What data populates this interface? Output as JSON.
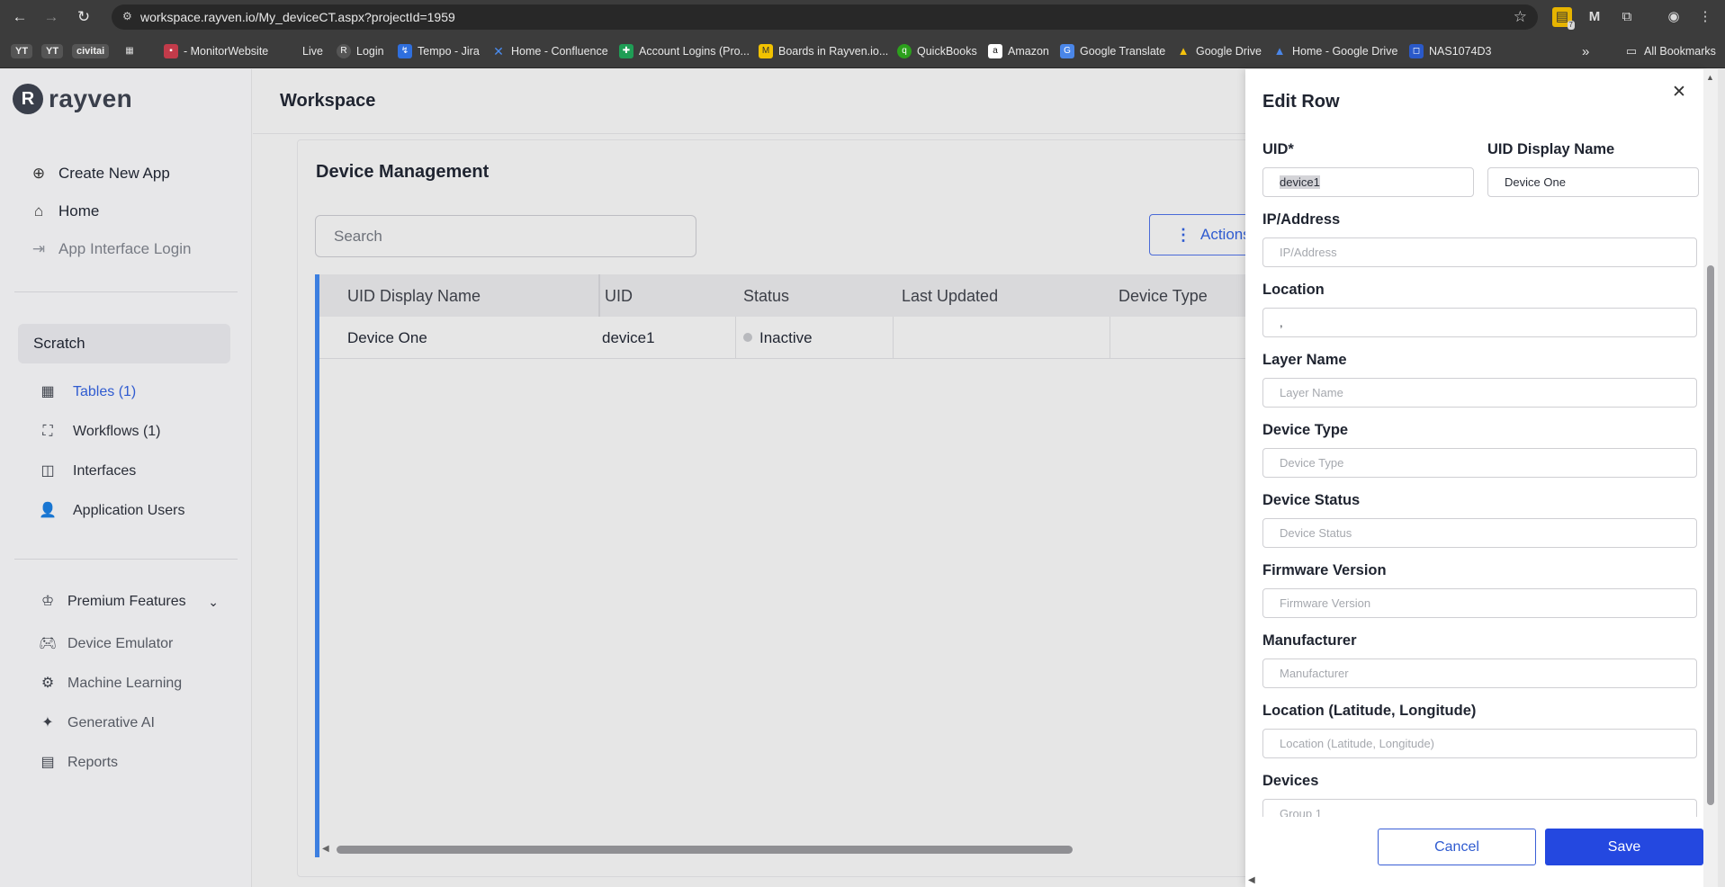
{
  "browser": {
    "url": "workspace.rayven.io/My_deviceCT.aspx?projectId=1959",
    "ext_badge": "7",
    "bookmarks": [
      {
        "label": "YT"
      },
      {
        "label": "YT"
      },
      {
        "label": "civitai"
      },
      {
        "label": "- MonitorWebsite"
      },
      {
        "label": "Live"
      },
      {
        "label": "Login"
      },
      {
        "label": "Tempo - Jira"
      },
      {
        "label": "Home - Confluence"
      },
      {
        "label": "Account Logins (Pro..."
      },
      {
        "label": "Boards in Rayven.io..."
      },
      {
        "label": "QuickBooks"
      },
      {
        "label": "Amazon"
      },
      {
        "label": "Google Translate"
      },
      {
        "label": "Google Drive"
      },
      {
        "label": "Home - Google Drive"
      },
      {
        "label": "NAS1074D3"
      }
    ],
    "more": "»",
    "all_bookmarks": "All Bookmarks"
  },
  "sidebar": {
    "logo_text": "rayven",
    "links": [
      {
        "label": "Create New App",
        "icon": "plus-circle-icon"
      },
      {
        "label": "Home",
        "icon": "home-icon"
      },
      {
        "label": "App Interface Login",
        "icon": "login-icon"
      }
    ],
    "section": "Scratch",
    "items": [
      {
        "label": "Tables (1)",
        "icon": "table-icon"
      },
      {
        "label": "Workflows (1)",
        "icon": "workflow-icon"
      },
      {
        "label": "Interfaces",
        "icon": "interface-icon"
      },
      {
        "label": "Application Users",
        "icon": "users-icon"
      }
    ],
    "premium": {
      "label": "Premium Features",
      "icon": "crown-icon"
    },
    "premium_items": [
      {
        "label": "Device Emulator",
        "icon": "gamepad-icon"
      },
      {
        "label": "Machine Learning",
        "icon": "chip-icon"
      },
      {
        "label": "Generative AI",
        "icon": "magic-wand-icon"
      },
      {
        "label": "Reports",
        "icon": "report-icon"
      }
    ]
  },
  "main": {
    "title": "Workspace",
    "card_title": "Device Management",
    "search_placeholder": "Search",
    "actions_label": "Actions",
    "table": {
      "columns": [
        "UID Display Name",
        "UID",
        "Status",
        "Last Updated",
        "Device Type"
      ],
      "rows": [
        {
          "display_name": "Device One",
          "uid": "device1",
          "status": "Inactive",
          "last_updated": "",
          "device_type": ""
        }
      ]
    }
  },
  "panel": {
    "title": "Edit Row",
    "fields": {
      "uid": {
        "label": "UID*",
        "value": "device1"
      },
      "uid_display": {
        "label": "UID Display Name",
        "value": "Device One"
      },
      "ip": {
        "label": "IP/Address",
        "placeholder": "IP/Address"
      },
      "location": {
        "label": "Location",
        "value": ","
      },
      "layer": {
        "label": "Layer Name",
        "placeholder": "Layer Name"
      },
      "device_type": {
        "label": "Device Type",
        "placeholder": "Device Type"
      },
      "device_status": {
        "label": "Device Status",
        "placeholder": "Device Status"
      },
      "firmware": {
        "label": "Firmware Version",
        "placeholder": "Firmware Version"
      },
      "manufacturer": {
        "label": "Manufacturer",
        "placeholder": "Manufacturer"
      },
      "latlng": {
        "label": "Location (Latitude, Longitude)",
        "placeholder": "Location (Latitude, Longitude)"
      },
      "devices": {
        "label": "Devices",
        "value": "Group 1"
      }
    },
    "cancel": "Cancel",
    "save": "Save"
  },
  "colors": {
    "accent": "#2448e0",
    "table_border": "#3c7fe0"
  }
}
